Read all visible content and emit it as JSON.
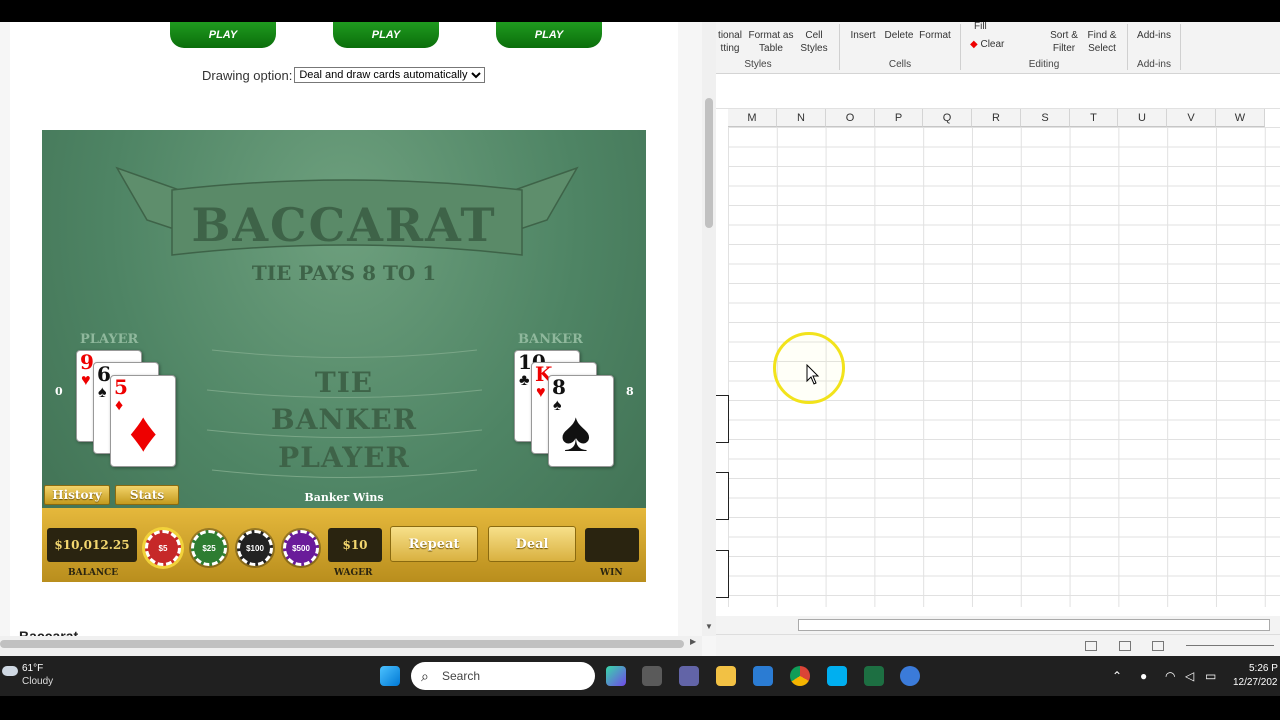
{
  "browser": {
    "play_buttons": [
      "PLAY",
      "PLAY",
      "PLAY"
    ],
    "drawing_option_label": "Drawing option:",
    "drawing_option_value": "Deal and draw cards automatically",
    "footer_heading": "Baccarat"
  },
  "game": {
    "title": "BACCARAT",
    "subtitle": "TIE PAYS 8 TO 1",
    "player_label": "PLAYER",
    "banker_label": "BANKER",
    "player_score": "0",
    "banker_score": "8",
    "bet_areas": [
      "TIE",
      "BANKER",
      "PLAYER"
    ],
    "player_cards": [
      {
        "rank": "9",
        "suit": "♥",
        "color": "#e00000"
      },
      {
        "rank": "6",
        "suit": "♠",
        "color": "#111111"
      },
      {
        "rank": "5",
        "suit": "♦",
        "color": "#e00000"
      }
    ],
    "banker_cards": [
      {
        "rank": "10",
        "suit": "♣",
        "color": "#111111"
      },
      {
        "rank": "K",
        "suit": "♥",
        "color": "#e00000"
      },
      {
        "rank": "8",
        "suit": "♠",
        "color": "#111111"
      }
    ],
    "history_button": "History",
    "stats_button": "Stats",
    "status_text": "Banker Wins",
    "balance": "$10,012.25",
    "balance_label": "BALANCE",
    "chips": [
      {
        "label": "$5",
        "color": "#c62828"
      },
      {
        "label": "$25",
        "color": "#2e7d32"
      },
      {
        "label": "$100",
        "color": "#222222"
      },
      {
        "label": "$500",
        "color": "#6a1b9a"
      }
    ],
    "wager": "$10",
    "wager_label": "WAGER",
    "repeat_button": "Repeat",
    "deal_button": "Deal",
    "win_value": "",
    "win_label": "WIN"
  },
  "excel": {
    "ribbon": {
      "conditional": [
        "tional",
        "tting"
      ],
      "format_as_table": [
        "Format as",
        "Table"
      ],
      "cell_styles": [
        "Cell",
        "Styles"
      ],
      "insert": "Insert",
      "delete": "Delete",
      "format": "Format",
      "fill": "Fill",
      "clear": "Clear",
      "sort_filter": [
        "Sort &",
        "Filter"
      ],
      "find_select": [
        "Find &",
        "Select"
      ],
      "addins": "Add-ins",
      "groups": {
        "styles": "Styles",
        "cells": "Cells",
        "editing": "Editing",
        "addins": "Add-ins"
      }
    },
    "columns": [
      "M",
      "N",
      "O",
      "P",
      "Q",
      "R",
      "S",
      "T",
      "U",
      "V",
      "W"
    ]
  },
  "taskbar": {
    "weather_temp": "61°F",
    "weather_condition": "Cloudy",
    "search_placeholder": "Search",
    "time": "5:26 P",
    "date": "12/27/202"
  }
}
